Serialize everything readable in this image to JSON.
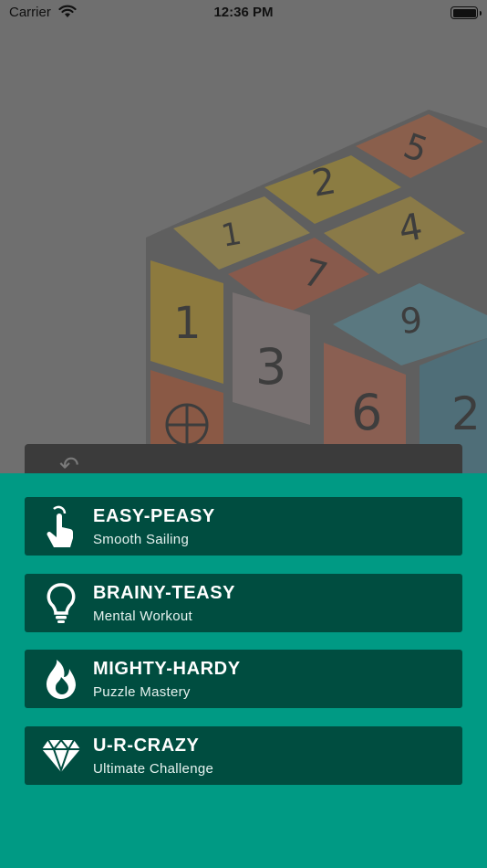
{
  "status_bar": {
    "carrier": "Carrier",
    "time": "12:36 PM",
    "icons": [
      "wifi-icon",
      "battery-icon"
    ]
  },
  "background": {
    "description_tiles": [
      "1",
      "2",
      "3",
      "4",
      "5",
      "6",
      "7",
      "9",
      "1",
      "2"
    ]
  },
  "levels": [
    {
      "title": "EASY-PEASY",
      "subtitle": "Smooth Sailing",
      "icon": "tap-hand-icon"
    },
    {
      "title": "BRAINY-TEASY",
      "subtitle": "Mental Workout",
      "icon": "lightbulb-icon"
    },
    {
      "title": "MIGHTY-HARDY",
      "subtitle": "Puzzle Mastery",
      "icon": "flame-icon"
    },
    {
      "title": "U-R-CRAZY",
      "subtitle": "Ultimate Challenge",
      "icon": "diamond-icon"
    }
  ],
  "colors": {
    "sheet": "#009a84",
    "card": "#004d40",
    "text": "#ffffff"
  }
}
